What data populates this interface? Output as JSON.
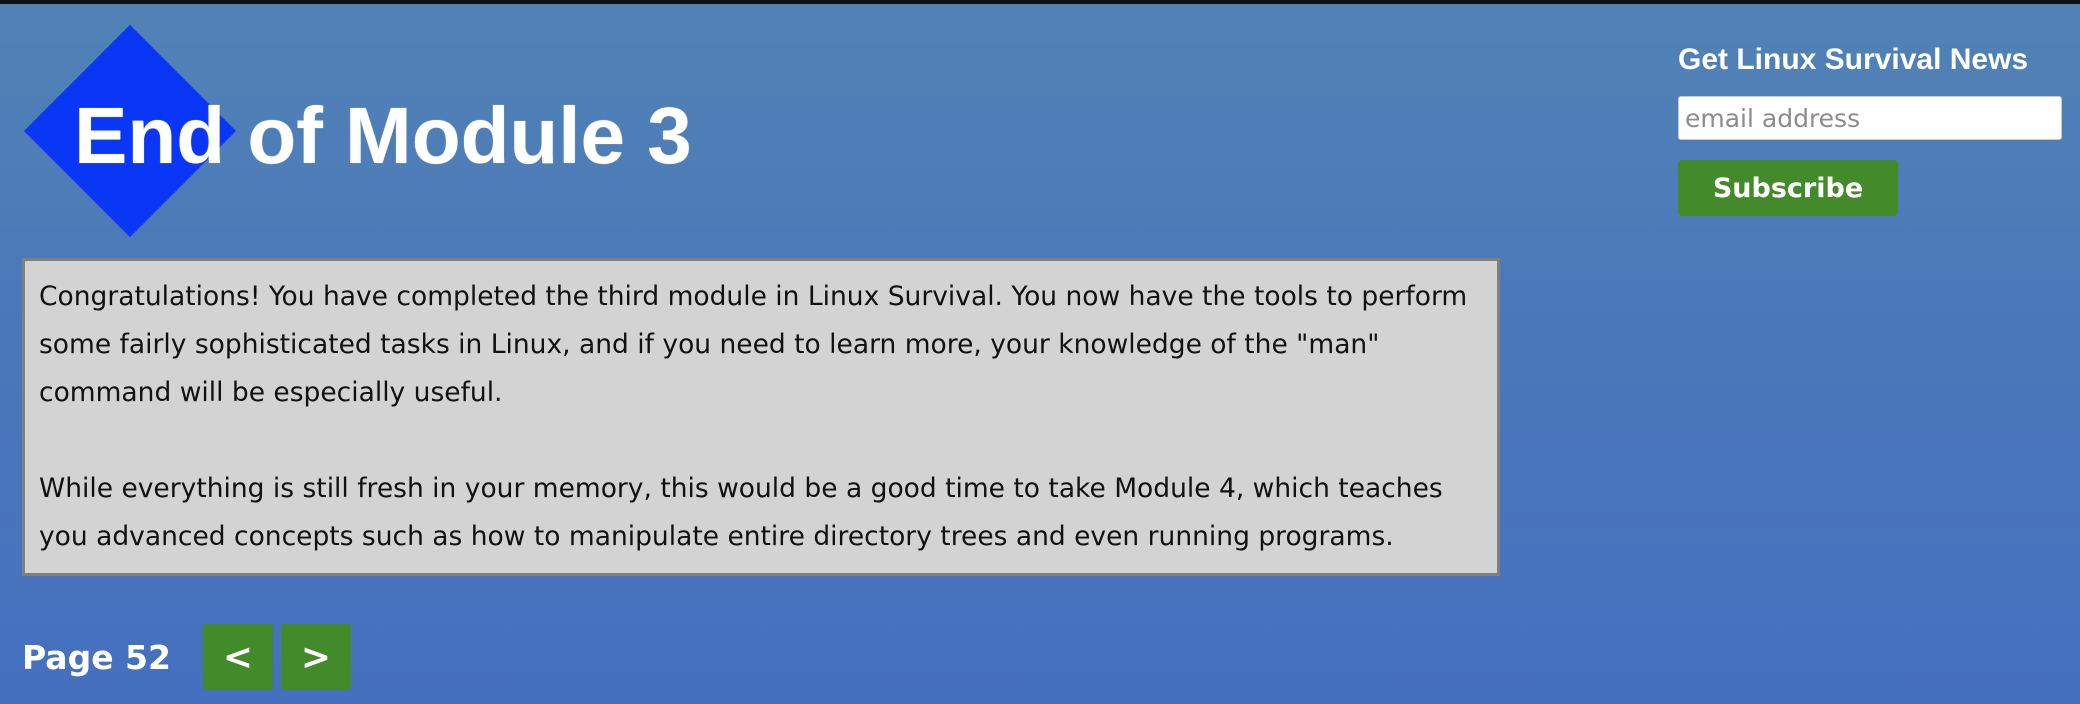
{
  "header": {
    "title": "End of Module 3"
  },
  "newsletter": {
    "heading": "Get Linux Survival News",
    "email_placeholder": "email address",
    "email_value": "",
    "subscribe_label": "Subscribe"
  },
  "content": {
    "paragraphs": [
      "Congratulations! You have completed the third module in Linux Survival. You now have the tools to perform some fairly sophisticated tasks in Linux, and if you need to learn more, your knowledge of the \"man\" command will be especially useful.",
      "While everything is still fresh in your memory, this would be a good time to take Module 4, which teaches you advanced concepts such as how to manipulate entire directory trees and even running programs."
    ]
  },
  "pager": {
    "page_label": "Page 52",
    "prev_label": "<",
    "next_label": ">"
  },
  "colors": {
    "background_top": "#5183b5",
    "background_bottom": "#4570bf",
    "diamond": "#0a36f5",
    "button_green": "#438a2a",
    "content_box_bg": "#d3d3d3",
    "content_box_border": "#808080"
  },
  "icons": {
    "logo_shape": "blue-diamond-icon"
  }
}
